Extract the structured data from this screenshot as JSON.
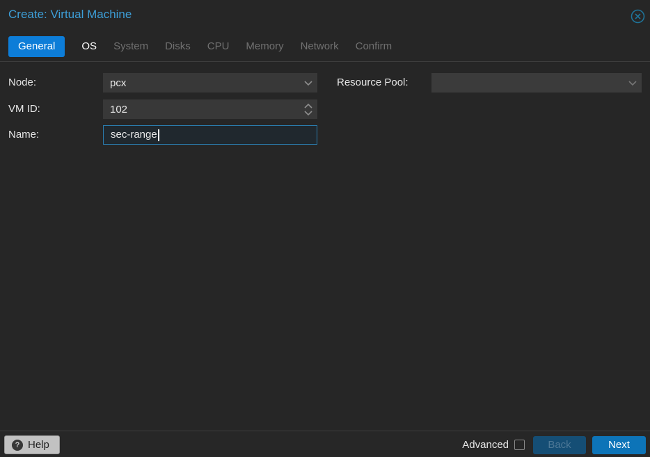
{
  "dialog": {
    "title": "Create: Virtual Machine",
    "close_icon": "circle-x-icon"
  },
  "tabs": [
    {
      "label": "General",
      "state": "active"
    },
    {
      "label": "OS",
      "state": "enabled"
    },
    {
      "label": "System",
      "state": "disabled"
    },
    {
      "label": "Disks",
      "state": "disabled"
    },
    {
      "label": "CPU",
      "state": "disabled"
    },
    {
      "label": "Memory",
      "state": "disabled"
    },
    {
      "label": "Network",
      "state": "disabled"
    },
    {
      "label": "Confirm",
      "state": "disabled"
    }
  ],
  "form": {
    "node": {
      "label": "Node:",
      "value": "pcx",
      "control": "combobox"
    },
    "vmid": {
      "label": "VM ID:",
      "value": "102",
      "control": "spinner"
    },
    "name": {
      "label": "Name:",
      "value": "sec-range",
      "control": "textfield",
      "focused": true
    },
    "pool": {
      "label": "Resource Pool:",
      "value": "",
      "control": "combobox",
      "disabled": true
    }
  },
  "footer": {
    "help_label": "Help",
    "help_icon": "question-mark",
    "advanced_label": "Advanced",
    "advanced_checked": false,
    "back_label": "Back",
    "next_label": "Next"
  },
  "colors": {
    "dialog_background": "#262626",
    "title_text": "#3d9ed7",
    "active_tab": "#0d7dd8",
    "disabled_tab_text": "#707070",
    "field_background": "#383838",
    "focused_field_border": "#2a7cae",
    "focused_field_background": "#20282e",
    "next_button": "#0d74b8",
    "back_button": "#154e75",
    "help_button": "#c2c2c2",
    "close_icon": "#1f7398"
  }
}
